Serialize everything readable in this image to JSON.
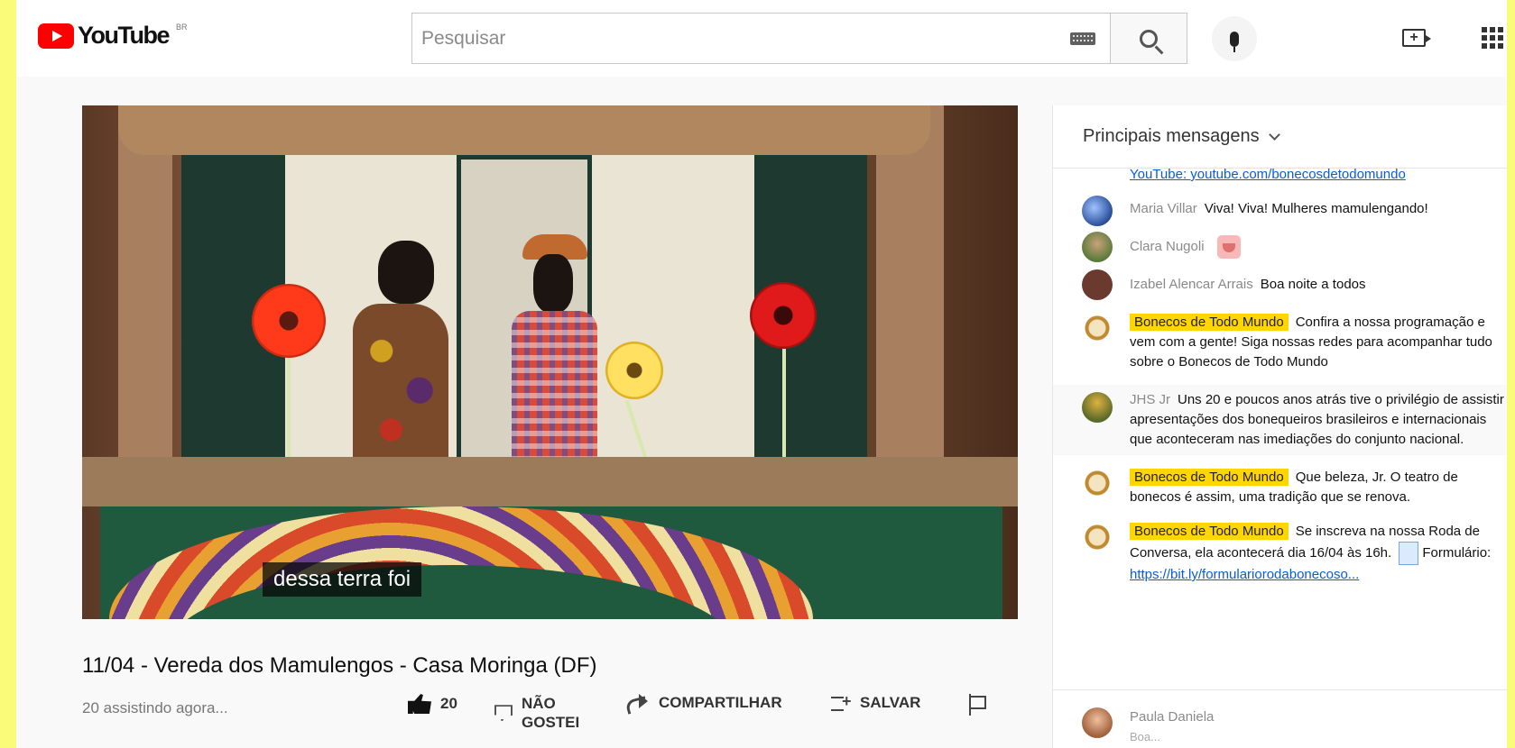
{
  "app": {
    "logo_text": "YouTube",
    "logo_region": "BR"
  },
  "search": {
    "placeholder": "Pesquisar"
  },
  "video": {
    "caption": "dessa terra foi",
    "title": "11/04 - Vereda dos Mamulengos - Casa Moringa (DF)",
    "views": "20 assistindo agora..."
  },
  "actions": {
    "like_count": "20",
    "dislike_line1": "NÃO",
    "dislike_line2": "GOSTEI",
    "share_label": "COMPARTILHAR",
    "save_label": "SALVAR"
  },
  "chat": {
    "header": "Principais mensagens",
    "partial_top": "YouTube: youtube.com/bonecosdetodomundo",
    "messages": [
      {
        "author": "Maria Villar",
        "text": "Viva! Viva! Mulheres mamulengando!",
        "owner": false
      },
      {
        "author": "Clara Nugoli",
        "text": "",
        "owner": false,
        "sticker": true
      },
      {
        "author": "Izabel Alencar Arrais",
        "text": "Boa noite a todos",
        "owner": false
      },
      {
        "author": "Bonecos de Todo Mundo",
        "text": "Confira a nossa programação e vem com a gente! Siga nossas redes para acompanhar tudo sobre o Bonecos de Todo Mundo",
        "owner": true
      },
      {
        "author": "JHS Jr",
        "text": "Uns 20 e poucos anos atrás tive o privilégio de assistir apresentações dos bonequeiros brasileiros e internacionais que aconteceram nas imediações do conjunto nacional.",
        "owner": false
      },
      {
        "author": "Bonecos de Todo Mundo",
        "text": "Que beleza, Jr. O teatro de bonecos é assim, uma tradição que se renova.",
        "owner": true
      },
      {
        "author": "Bonecos de Todo Mundo",
        "text_before": "Se inscreva na nossa Roda de Conversa, ela acontecerá dia 16/04 às 16h.",
        "text_after": "Formulário:",
        "link": "https://bit.ly/formulariorodabonecoso...",
        "owner": true
      }
    ],
    "bottom_author": "Paula Daniela",
    "bottom_sub": "Boa..."
  },
  "colors": {
    "brand_red": "#ff0000",
    "owner_badge": "#ffd600",
    "link": "#065fd4",
    "frame_border": "#fbfb7a"
  }
}
